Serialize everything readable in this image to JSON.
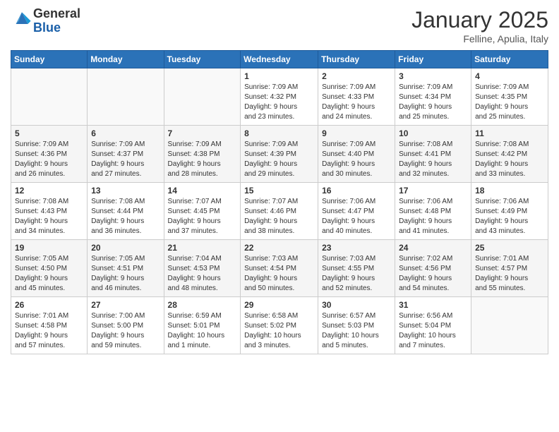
{
  "header": {
    "logo_general": "General",
    "logo_blue": "Blue",
    "month_title": "January 2025",
    "location": "Felline, Apulia, Italy"
  },
  "weekdays": [
    "Sunday",
    "Monday",
    "Tuesday",
    "Wednesday",
    "Thursday",
    "Friday",
    "Saturday"
  ],
  "weeks": [
    [
      {
        "day": "",
        "info": ""
      },
      {
        "day": "",
        "info": ""
      },
      {
        "day": "",
        "info": ""
      },
      {
        "day": "1",
        "info": "Sunrise: 7:09 AM\nSunset: 4:32 PM\nDaylight: 9 hours\nand 23 minutes."
      },
      {
        "day": "2",
        "info": "Sunrise: 7:09 AM\nSunset: 4:33 PM\nDaylight: 9 hours\nand 24 minutes."
      },
      {
        "day": "3",
        "info": "Sunrise: 7:09 AM\nSunset: 4:34 PM\nDaylight: 9 hours\nand 25 minutes."
      },
      {
        "day": "4",
        "info": "Sunrise: 7:09 AM\nSunset: 4:35 PM\nDaylight: 9 hours\nand 25 minutes."
      }
    ],
    [
      {
        "day": "5",
        "info": "Sunrise: 7:09 AM\nSunset: 4:36 PM\nDaylight: 9 hours\nand 26 minutes."
      },
      {
        "day": "6",
        "info": "Sunrise: 7:09 AM\nSunset: 4:37 PM\nDaylight: 9 hours\nand 27 minutes."
      },
      {
        "day": "7",
        "info": "Sunrise: 7:09 AM\nSunset: 4:38 PM\nDaylight: 9 hours\nand 28 minutes."
      },
      {
        "day": "8",
        "info": "Sunrise: 7:09 AM\nSunset: 4:39 PM\nDaylight: 9 hours\nand 29 minutes."
      },
      {
        "day": "9",
        "info": "Sunrise: 7:09 AM\nSunset: 4:40 PM\nDaylight: 9 hours\nand 30 minutes."
      },
      {
        "day": "10",
        "info": "Sunrise: 7:08 AM\nSunset: 4:41 PM\nDaylight: 9 hours\nand 32 minutes."
      },
      {
        "day": "11",
        "info": "Sunrise: 7:08 AM\nSunset: 4:42 PM\nDaylight: 9 hours\nand 33 minutes."
      }
    ],
    [
      {
        "day": "12",
        "info": "Sunrise: 7:08 AM\nSunset: 4:43 PM\nDaylight: 9 hours\nand 34 minutes."
      },
      {
        "day": "13",
        "info": "Sunrise: 7:08 AM\nSunset: 4:44 PM\nDaylight: 9 hours\nand 36 minutes."
      },
      {
        "day": "14",
        "info": "Sunrise: 7:07 AM\nSunset: 4:45 PM\nDaylight: 9 hours\nand 37 minutes."
      },
      {
        "day": "15",
        "info": "Sunrise: 7:07 AM\nSunset: 4:46 PM\nDaylight: 9 hours\nand 38 minutes."
      },
      {
        "day": "16",
        "info": "Sunrise: 7:06 AM\nSunset: 4:47 PM\nDaylight: 9 hours\nand 40 minutes."
      },
      {
        "day": "17",
        "info": "Sunrise: 7:06 AM\nSunset: 4:48 PM\nDaylight: 9 hours\nand 41 minutes."
      },
      {
        "day": "18",
        "info": "Sunrise: 7:06 AM\nSunset: 4:49 PM\nDaylight: 9 hours\nand 43 minutes."
      }
    ],
    [
      {
        "day": "19",
        "info": "Sunrise: 7:05 AM\nSunset: 4:50 PM\nDaylight: 9 hours\nand 45 minutes."
      },
      {
        "day": "20",
        "info": "Sunrise: 7:05 AM\nSunset: 4:51 PM\nDaylight: 9 hours\nand 46 minutes."
      },
      {
        "day": "21",
        "info": "Sunrise: 7:04 AM\nSunset: 4:53 PM\nDaylight: 9 hours\nand 48 minutes."
      },
      {
        "day": "22",
        "info": "Sunrise: 7:03 AM\nSunset: 4:54 PM\nDaylight: 9 hours\nand 50 minutes."
      },
      {
        "day": "23",
        "info": "Sunrise: 7:03 AM\nSunset: 4:55 PM\nDaylight: 9 hours\nand 52 minutes."
      },
      {
        "day": "24",
        "info": "Sunrise: 7:02 AM\nSunset: 4:56 PM\nDaylight: 9 hours\nand 54 minutes."
      },
      {
        "day": "25",
        "info": "Sunrise: 7:01 AM\nSunset: 4:57 PM\nDaylight: 9 hours\nand 55 minutes."
      }
    ],
    [
      {
        "day": "26",
        "info": "Sunrise: 7:01 AM\nSunset: 4:58 PM\nDaylight: 9 hours\nand 57 minutes."
      },
      {
        "day": "27",
        "info": "Sunrise: 7:00 AM\nSunset: 5:00 PM\nDaylight: 9 hours\nand 59 minutes."
      },
      {
        "day": "28",
        "info": "Sunrise: 6:59 AM\nSunset: 5:01 PM\nDaylight: 10 hours\nand 1 minute."
      },
      {
        "day": "29",
        "info": "Sunrise: 6:58 AM\nSunset: 5:02 PM\nDaylight: 10 hours\nand 3 minutes."
      },
      {
        "day": "30",
        "info": "Sunrise: 6:57 AM\nSunset: 5:03 PM\nDaylight: 10 hours\nand 5 minutes."
      },
      {
        "day": "31",
        "info": "Sunrise: 6:56 AM\nSunset: 5:04 PM\nDaylight: 10 hours\nand 7 minutes."
      },
      {
        "day": "",
        "info": ""
      }
    ]
  ]
}
